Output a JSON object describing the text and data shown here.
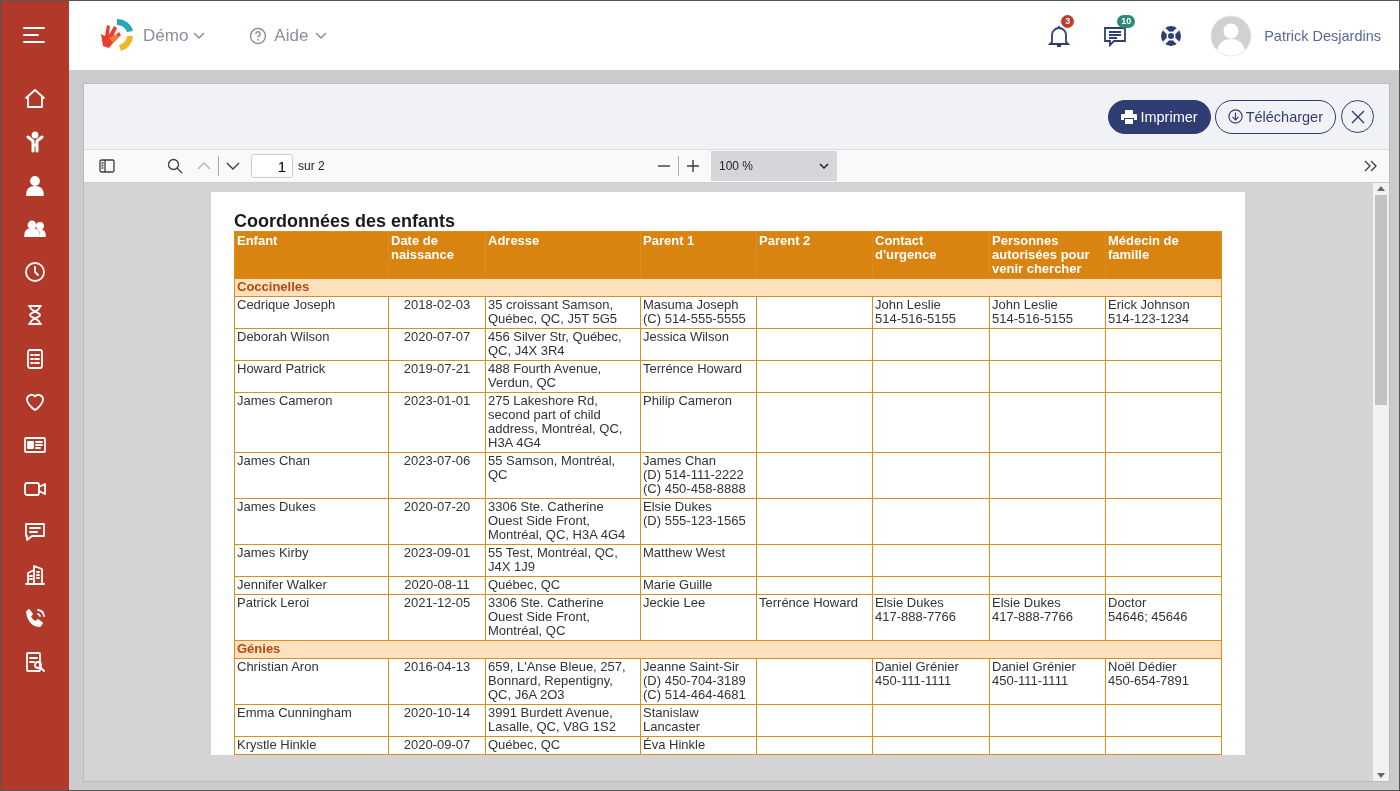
{
  "topbar": {
    "brand": "Démo",
    "help": "Aide",
    "notifications": "3",
    "messages": "10",
    "user": "Patrick Desjardins"
  },
  "modal": {
    "buttons": [
      {
        "kind": "print",
        "label": "Imprimer"
      },
      {
        "kind": "download",
        "label": "Télécharger"
      }
    ]
  },
  "viewer": {
    "page": "1",
    "page_count": "sur 2",
    "zoom": "100 %"
  },
  "document": {
    "title": "Coordonnées des enfants",
    "columns": [
      "Enfant",
      "Date de naissance",
      "Adresse",
      "Parent 1",
      "Parent 2",
      "Contact d'urgence",
      "Personnes autorisées pour venir chercher",
      "Médecin de famille"
    ],
    "groups": [
      {
        "name": "Coccinelles",
        "rows": [
          [
            "Cedrique Joseph",
            "2018-02-03",
            "35 croissant Samson, Québec, QC, J5T 5G5",
            "Masuma Joseph\n(C) 514-555-5555",
            "",
            "John Leslie\n514-516-5155",
            "John Leslie\n514-516-5155",
            "Erick Johnson\n514-123-1234"
          ],
          [
            "Deborah Wilson",
            "2020-07-07",
            "456 Silver Str, Québec, QC, J4X 3R4",
            "Jessica Wilson",
            "",
            "",
            "",
            ""
          ],
          [
            "Howard Patrick",
            "2019-07-21",
            "488 Fourth Avenue, Verdun, QC",
            "Terrénce Howard",
            "",
            "",
            "",
            ""
          ],
          [
            "James Cameron",
            "2023-01-01",
            "275 Lakeshore Rd, second part of child address, Montréal, QC, H3A 4G4",
            "Philip Cameron",
            "",
            "",
            "",
            ""
          ],
          [
            "James Chan",
            "2023-07-06",
            "55 Samson, Montréal, QC",
            "James Chan\n(D) 514-111-2222\n(C) 450-458-8888",
            "",
            "",
            "",
            ""
          ],
          [
            "James Dukes",
            "2020-07-20",
            "3306 Ste. Catherine Ouest Side Front, Montréal, QC, H3A 4G4",
            "Elsie Dukes\n(D) 555-123-1565",
            "",
            "",
            "",
            ""
          ],
          [
            "James Kirby",
            "2023-09-01",
            "55 Test, Montréal, QC, J4X 1J9",
            "Matthew West",
            "",
            "",
            "",
            ""
          ],
          [
            "Jennifer Walker",
            "2020-08-11",
            "Québec, QC",
            "Marie Guille",
            "",
            "",
            "",
            ""
          ],
          [
            "Patrick Leroi",
            "2021-12-05",
            "3306 Ste. Catherine Ouest Side Front, Montréal, QC",
            "Jeckie Lee",
            "Terrénce Howard",
            "Elsie Dukes\n417-888-7766",
            "Elsie Dukes\n417-888-7766",
            "Doctor\n54646; 45646"
          ]
        ]
      },
      {
        "name": "Génies",
        "rows": [
          [
            "Christian Aron",
            "2016-04-13",
            "659, L'Anse Bleue, 257, Bonnard, Repentigny, QC, J6A 2O3",
            "Jeanne Saint-Sir\n(D) 450-704-3189\n(C) 514-464-4681",
            "",
            "Daniel Grénier\n450-111-1111",
            "Daniel Grénier\n450-111-1111",
            "Noël Dédier\n450-654-7891"
          ],
          [
            "Emma Cunningham",
            "2020-10-14",
            "3991 Burdett Avenue, Lasalle, QC, V8G 1S2",
            "Stanislaw Lancaster",
            "",
            "",
            "",
            ""
          ],
          [
            "Krystle Hinkle",
            "2020-09-07",
            "Québec, QC",
            "Éva Hinkle",
            "",
            "",
            "",
            ""
          ]
        ]
      }
    ]
  }
}
